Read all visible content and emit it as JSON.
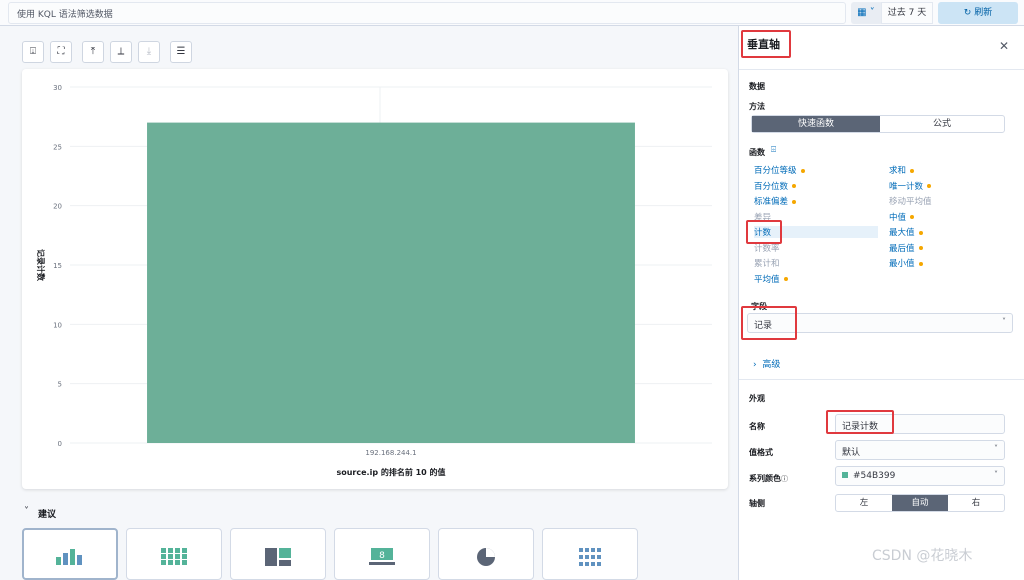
{
  "topbar": {
    "query_placeholder": "使用 KQL 语法筛选数据",
    "date_range": "过去 7 天",
    "refresh_label": "刷新"
  },
  "chart_data": {
    "type": "bar",
    "categories": [
      "192.168.244.1"
    ],
    "values": [
      27
    ],
    "xlabel": "source.ip 的排名前 10 的值",
    "ylabel": "记录计数",
    "ylim": [
      0,
      30
    ],
    "yticks": [
      0,
      5,
      10,
      15,
      20,
      25,
      30
    ],
    "color": "#6DAF98"
  },
  "suggestions": {
    "title": "建议"
  },
  "panel": {
    "title": "垂直轴",
    "data_label": "数据",
    "method_label": "方法",
    "method_options": [
      "快速函数",
      "公式"
    ],
    "functions_label": "函数",
    "functions_left": [
      {
        "label": "百分位等级",
        "dot": true,
        "disabled": false
      },
      {
        "label": "百分位数",
        "dot": true,
        "disabled": false
      },
      {
        "label": "标准偏差",
        "dot": true,
        "disabled": false
      },
      {
        "label": "差异",
        "dot": false,
        "disabled": true
      },
      {
        "label": "计数",
        "dot": false,
        "disabled": false
      },
      {
        "label": "计数率",
        "dot": false,
        "disabled": true
      },
      {
        "label": "累计和",
        "dot": false,
        "disabled": true
      },
      {
        "label": "平均值",
        "dot": true,
        "disabled": false
      }
    ],
    "functions_right": [
      {
        "label": "求和",
        "dot": true,
        "disabled": false
      },
      {
        "label": "唯一计数",
        "dot": true,
        "disabled": false
      },
      {
        "label": "移动平均值",
        "dot": false,
        "disabled": true
      },
      {
        "label": "中值",
        "dot": true,
        "disabled": false
      },
      {
        "label": "最大值",
        "dot": true,
        "disabled": false
      },
      {
        "label": "最后值",
        "dot": true,
        "disabled": false
      },
      {
        "label": "最小值",
        "dot": true,
        "disabled": false
      }
    ],
    "field_label": "字段",
    "field_value": "记录",
    "advanced_label": "高级",
    "appearance_label": "外观",
    "name_label": "名称",
    "name_value": "记录计数",
    "format_label": "值格式",
    "format_value": "默认",
    "color_label": "系列颜色",
    "color_value": "#54B399",
    "axis_label": "轴侧",
    "axis_options": [
      "左",
      "自动",
      "右"
    ]
  },
  "watermark": "CSDN @花晓木",
  "colors": {
    "accent": "#006bb8",
    "bar": "#6DAF98",
    "highlight": "#e0393e",
    "series": "#54B399"
  }
}
